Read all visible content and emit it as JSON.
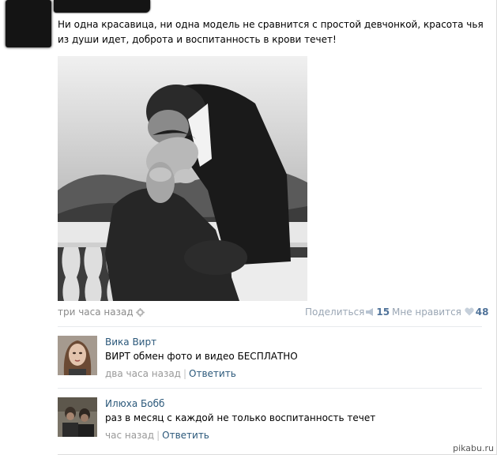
{
  "post": {
    "text": "Ни одна красавица, ни одна модель не сравнится с простой девчонкой, красота чья из души идет, доброта и воспитанность в крови течет!",
    "time": "три часа назад",
    "share_label": "Поделиться",
    "share_count": "15",
    "like_label": "Мне нравится",
    "like_count": "48"
  },
  "comments": [
    {
      "author": "Вика Вирт",
      "text": "ВИРТ обмен фото и видео БЕСПЛАТНО",
      "time": "два часа назад",
      "reply": "Ответить"
    },
    {
      "author": "Илюха Бобб",
      "text": "раз в месяц с каждой не только воспитанность течет",
      "time": "час назад",
      "reply": "Ответить"
    }
  ],
  "watermark": "pikabu.ru",
  "icons": {
    "settings": "gear-icon",
    "share": "megaphone-icon",
    "like": "heart-icon"
  },
  "colors": {
    "link": "#2b587a",
    "count": "#4f7299",
    "muted": "#999999"
  }
}
